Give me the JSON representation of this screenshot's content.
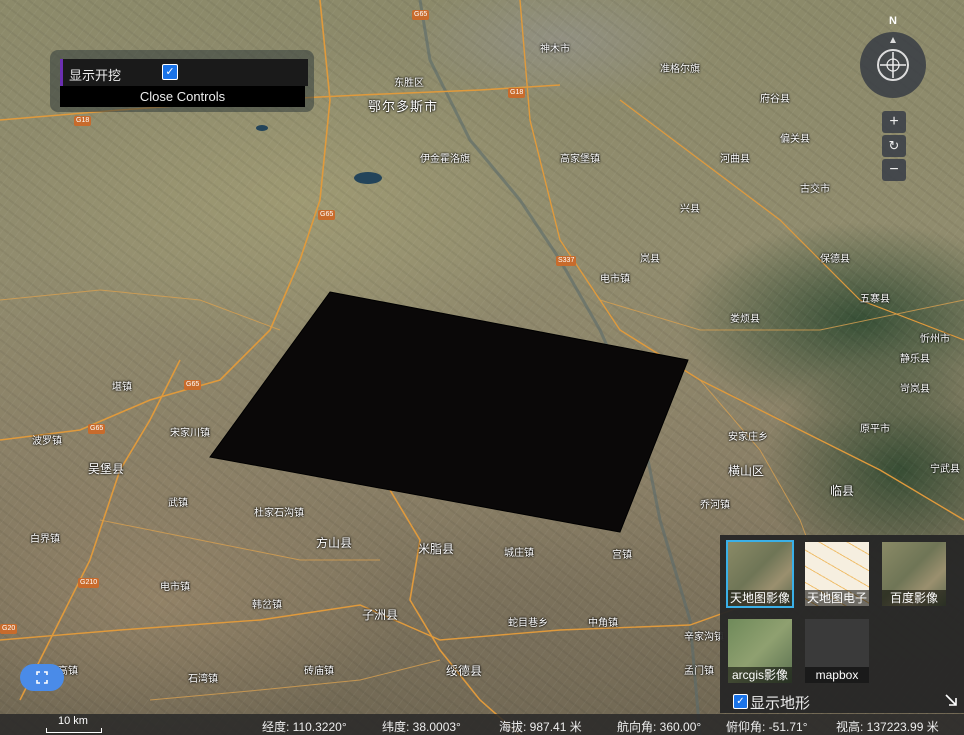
{
  "map": {
    "labels": [
      {
        "text": "鄂尔多斯市",
        "cls": "city"
      },
      {
        "text": "东胜区",
        "cls": ""
      },
      {
        "text": "米脂县",
        "cls": "big"
      },
      {
        "text": "子洲县",
        "cls": "big"
      },
      {
        "text": "绥德县",
        "cls": "big"
      },
      {
        "text": "吴堡县",
        "cls": "big"
      },
      {
        "text": "横山区",
        "cls": "big"
      },
      {
        "text": "临县",
        "cls": "big"
      },
      {
        "text": "方山县",
        "cls": "big"
      },
      {
        "text": "杜家石沟镇",
        "cls": ""
      },
      {
        "text": "武镇",
        "cls": ""
      },
      {
        "text": "韩岔镇",
        "cls": ""
      },
      {
        "text": "电市镇",
        "cls": ""
      },
      {
        "text": "高镇",
        "cls": ""
      },
      {
        "text": "石湾镇",
        "cls": ""
      },
      {
        "text": "砖庙镇",
        "cls": ""
      },
      {
        "text": "蛇目巷乡",
        "cls": ""
      },
      {
        "text": "中角镇",
        "cls": ""
      },
      {
        "text": "辛家沟镇",
        "cls": ""
      },
      {
        "text": "孟门镇",
        "cls": ""
      },
      {
        "text": "宋家川镇",
        "cls": ""
      },
      {
        "text": "乔河镇",
        "cls": ""
      },
      {
        "text": "安家庄乡",
        "cls": ""
      },
      {
        "text": "城庄镇",
        "cls": ""
      },
      {
        "text": "宫镇",
        "cls": ""
      },
      {
        "text": "堪镇",
        "cls": ""
      },
      {
        "text": "波罗镇",
        "cls": ""
      },
      {
        "text": "白界镇",
        "cls": ""
      },
      {
        "text": "高家堡镇",
        "cls": ""
      },
      {
        "text": "电市镇",
        "cls": ""
      },
      {
        "text": "兴县",
        "cls": ""
      },
      {
        "text": "岚县",
        "cls": ""
      },
      {
        "text": "娄烦县",
        "cls": ""
      },
      {
        "text": "神木市",
        "cls": ""
      },
      {
        "text": "伊金霍洛旗",
        "cls": ""
      },
      {
        "text": "准格尔旗",
        "cls": ""
      },
      {
        "text": "府谷县",
        "cls": ""
      },
      {
        "text": "偏关县",
        "cls": ""
      },
      {
        "text": "河曲县",
        "cls": ""
      },
      {
        "text": "保德县",
        "cls": ""
      },
      {
        "text": "五寨县",
        "cls": ""
      },
      {
        "text": "岢岚县",
        "cls": ""
      },
      {
        "text": "静乐县",
        "cls": ""
      },
      {
        "text": "宁武县",
        "cls": ""
      },
      {
        "text": "原平市",
        "cls": ""
      },
      {
        "text": "忻州市",
        "cls": ""
      },
      {
        "text": "古交市",
        "cls": ""
      }
    ],
    "road_badges": [
      "G65",
      "G18",
      "G65",
      "G65",
      "G210",
      "G20",
      "G18",
      "S337",
      "G65"
    ]
  },
  "dig_control": {
    "label": "显示开挖",
    "checked": true,
    "close_label": "Close Controls"
  },
  "navigation": {
    "north_label": "N",
    "zoom_in": "+",
    "reset": "↻",
    "zoom_out": "−"
  },
  "basemaps": {
    "tiles": [
      {
        "label": "天地图影像",
        "thumb": "satellite",
        "active": true
      },
      {
        "label": "天地图电子",
        "thumb": "vector",
        "active": false
      },
      {
        "label": "百度影像",
        "thumb": "satellite",
        "active": false
      },
      {
        "label": "arcgis影像",
        "thumb": "satellite-green",
        "active": false
      },
      {
        "label": "mapbox",
        "thumb": "dark",
        "active": false
      }
    ],
    "terrain_label": "显示地形",
    "terrain_checked": true
  },
  "status": {
    "scale": "10 km",
    "longitude": "经度: 110.3220°",
    "latitude": "纬度: 38.0003°",
    "elevation": "海拔: 987.41 米",
    "heading": "航向角: 360.00°",
    "pitch": "俯仰角: -51.71°",
    "view_height": "视高: 137223.99 米"
  },
  "colors": {
    "accent": "#1a73e8",
    "active_outline": "#3ab0e8",
    "road": "#c86b2c",
    "excavation": "#0a0808"
  }
}
